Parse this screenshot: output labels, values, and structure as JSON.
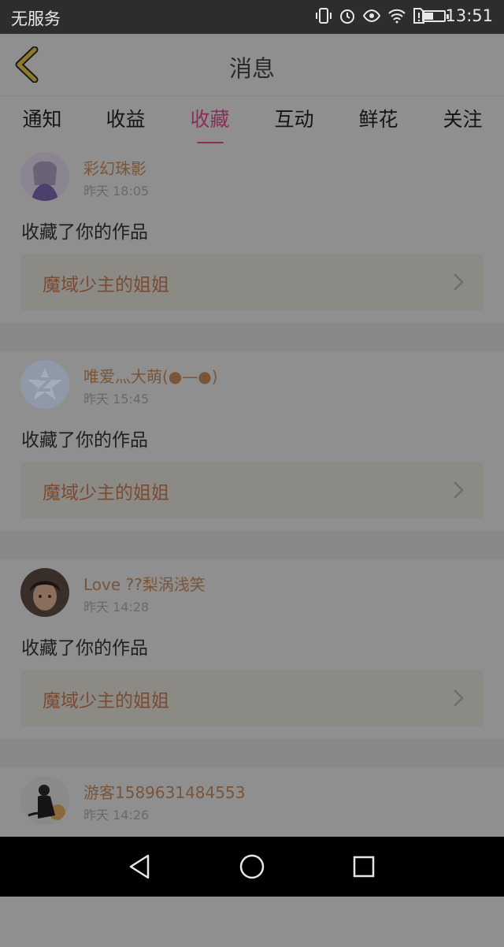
{
  "status_bar": {
    "carrier": "无服务",
    "time": "13:51",
    "battery_level": 0.45,
    "icons": [
      "vibrate-icon",
      "alarm-icon",
      "eye-icon",
      "wifi-icon",
      "sim-alert-icon",
      "battery-icon"
    ]
  },
  "header": {
    "title": "消息",
    "back_icon": "back-chevron-icon"
  },
  "tabs": [
    {
      "label": "通知"
    },
    {
      "label": "收益"
    },
    {
      "label": "收藏"
    },
    {
      "label": "互动"
    },
    {
      "label": "鲜花"
    },
    {
      "label": "关注"
    }
  ],
  "active_tab": "收藏",
  "colors": {
    "accent": "#8a2f5a",
    "username": "#7a5538",
    "work_title": "#7a4a33",
    "overlay_bg": "#8f8f8f"
  },
  "notifications": [
    {
      "username": "彩幻珠影",
      "time": "昨天 18:05",
      "action": "收藏了你的作品",
      "work_title": "魔域少主的姐姐"
    },
    {
      "username": "唯爱灬大萌(●—●)",
      "time": "昨天 15:45",
      "action": "收藏了你的作品",
      "work_title": "魔域少主的姐姐"
    },
    {
      "username": "Love ??梨涡浅笑",
      "time": "昨天 14:28",
      "action": "收藏了你的作品",
      "work_title": "魔域少主的姐姐"
    },
    {
      "username": "游客1589631484553",
      "time": "昨天 14:26"
    }
  ],
  "nav_bar": {
    "icons": [
      "back-triangle-icon",
      "home-circle-icon",
      "recents-square-icon"
    ]
  }
}
